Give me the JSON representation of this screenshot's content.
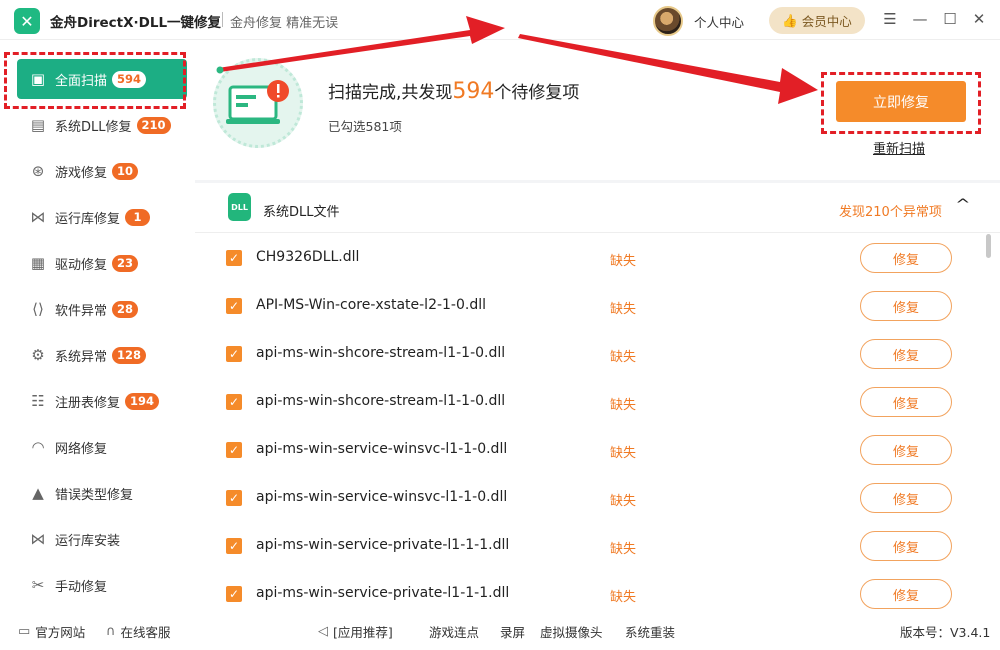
{
  "titlebar": {
    "logo_icon": "wrench-icon",
    "app_title": "金舟DirectX·DLL一键修复",
    "slogan": "金舟修复 精准无误",
    "profile_label": "个人中心",
    "vip_label": "会员中心",
    "vip_icon": "thumbs-up-icon",
    "controls": [
      "menu-icon",
      "minimize-icon",
      "maximize-icon",
      "close-icon"
    ]
  },
  "sidebar": {
    "items": [
      {
        "label": "全面扫描",
        "badge": "594",
        "icon": "scan-icon",
        "active": true
      },
      {
        "label": "系统DLL修复",
        "badge": "210",
        "icon": "dll-icon"
      },
      {
        "label": "游戏修复",
        "badge": "10",
        "icon": "gamepad-icon"
      },
      {
        "label": "运行库修复",
        "badge": "1",
        "icon": "visual-studio-icon"
      },
      {
        "label": "驱动修复",
        "badge": "23",
        "icon": "chip-icon"
      },
      {
        "label": "软件异常",
        "badge": "28",
        "icon": "code-window-icon"
      },
      {
        "label": "系统异常",
        "badge": "128",
        "icon": "gear-icon"
      },
      {
        "label": "注册表修复",
        "badge": "194",
        "icon": "list-icon"
      },
      {
        "label": "网络修复",
        "badge": "",
        "icon": "wifi-icon"
      },
      {
        "label": "错误类型修复",
        "badge": "",
        "icon": "warning-icon"
      },
      {
        "label": "运行库安装",
        "badge": "",
        "icon": "visual-studio-icon"
      },
      {
        "label": "手动修复",
        "badge": "",
        "icon": "tools-icon"
      }
    ]
  },
  "summary": {
    "title_prefix": "扫描完成,共发现",
    "count": "594",
    "title_suffix": "个待修复项",
    "selected_text": "已勾选581项",
    "repair_now_label": "立即修复",
    "rescan_label": "重新扫描"
  },
  "section": {
    "icon_text": "DLL",
    "title": "系统DLL文件",
    "count_text": "发现210个异常项",
    "toggle_icon": "chevron-up-icon"
  },
  "files": [
    {
      "name": "CH9326DLL.dll",
      "status": "缺失",
      "action": "修复"
    },
    {
      "name": "API-MS-Win-core-xstate-l2-1-0.dll",
      "status": "缺失",
      "action": "修复"
    },
    {
      "name": "api-ms-win-shcore-stream-l1-1-0.dll",
      "status": "缺失",
      "action": "修复"
    },
    {
      "name": "api-ms-win-shcore-stream-l1-1-0.dll",
      "status": "缺失",
      "action": "修复"
    },
    {
      "name": "api-ms-win-service-winsvc-l1-1-0.dll",
      "status": "缺失",
      "action": "修复"
    },
    {
      "name": "api-ms-win-service-winsvc-l1-1-0.dll",
      "status": "缺失",
      "action": "修复"
    },
    {
      "name": "api-ms-win-service-private-l1-1-1.dll",
      "status": "缺失",
      "action": "修复"
    },
    {
      "name": "api-ms-win-service-private-l1-1-1.dll",
      "status": "缺失",
      "action": "修复"
    }
  ],
  "footer": {
    "official_site": "官方网站",
    "online_service": "在线客服",
    "recommend_label": "[应用推荐]",
    "recommend_items": [
      "游戏连点",
      "录屏",
      "虚拟摄像头",
      "系统重装"
    ],
    "version": "版本号：V3.4.1"
  },
  "colors": {
    "accent_green": "#1cae84",
    "accent_orange": "#f58b2a",
    "annotation_red": "#e21f26"
  }
}
